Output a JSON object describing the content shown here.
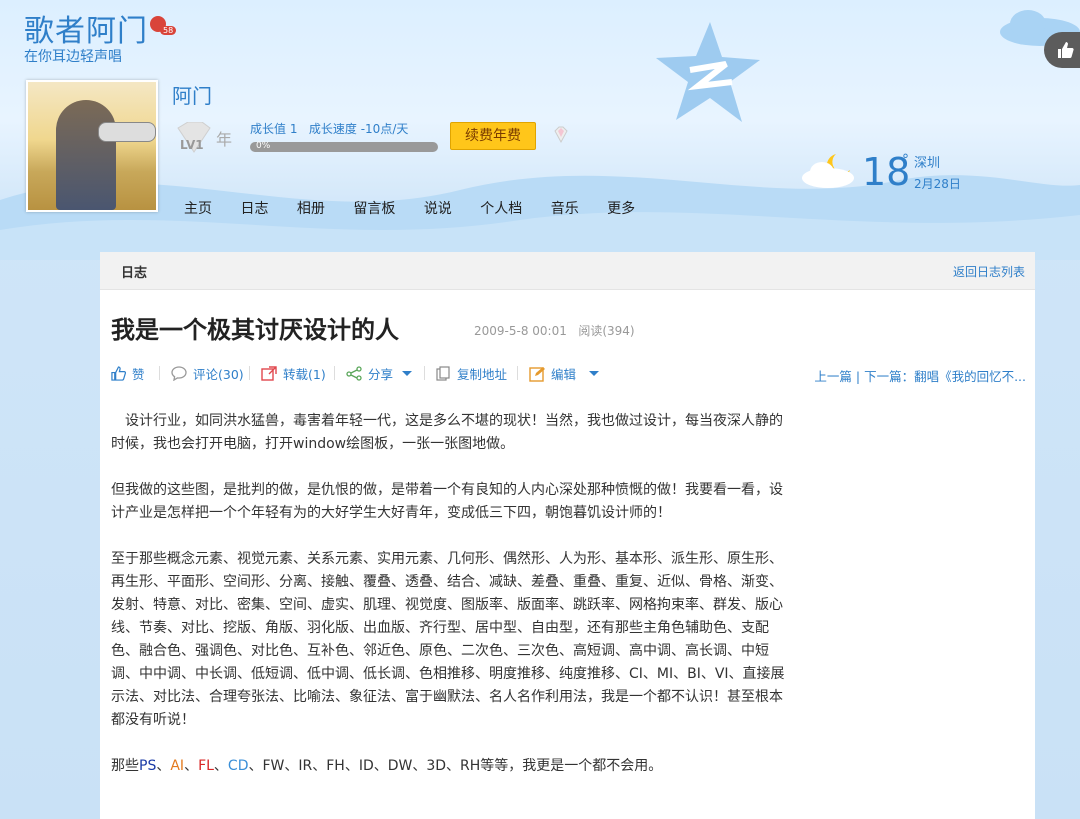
{
  "header": {
    "site_title": "歌者阿门",
    "site_subtitle": "在你耳边轻声唱",
    "apple_badge": "58",
    "username": "阿门",
    "level": "LV1",
    "year_label": "年",
    "growth_value": "成长值 1",
    "growth_speed": "成长速度 -10点/天",
    "growth_progress_percent": 0,
    "growth_progress_label": "0%",
    "renew_button": "续费年费"
  },
  "nav": {
    "items": [
      "主页",
      "日志",
      "相册",
      "留言板",
      "说说",
      "个人档",
      "音乐",
      "更多"
    ]
  },
  "weather": {
    "temperature": "18",
    "degree": "°",
    "city": "深圳",
    "date": "2月28日"
  },
  "panel": {
    "section_label": "日志",
    "back_link": "返回日志列表"
  },
  "post": {
    "title": "我是一个极其讨厌设计的人",
    "date": "2009-5-8 00:01",
    "reads": "阅读(394)",
    "actions": {
      "like": "赞",
      "comment": "评论(30)",
      "repost": "转载(1)",
      "share": "分享",
      "copy": "复制地址",
      "edit": "编辑"
    },
    "prev": "上一篇",
    "next_sep": " | ",
    "next": "下一篇：翻唱《我的回忆不...",
    "paragraph1": "　设计行业，如同洪水猛兽，毒害着年轻一代，这是多么不堪的现状！当然，我也做过设计，每当夜深人静的时候，我也会打开电脑，打开window绘图板，一张一张图地做。",
    "paragraph2": "但我做的这些图，是批判的做，是仇恨的做，是带着一个有良知的人内心深处那种愤慨的做！我要看一看，设计产业是怎样把一个个年轻有为的大好学生大好青年，变成低三下四，朝饱暮饥设计师的！",
    "paragraph3": "至于那些概念元素、视觉元素、关系元素、实用元素、几何形、偶然形、人为形、基本形、派生形、原生形、再生形、平面形、空间形、分离、接触、覆叠、透叠、结合、减缺、差叠、重叠、重复、近似、骨格、渐变、发射、特意、对比、密集、空间、虚实、肌理、视觉度、图版率、版面率、跳跃率、网格拘束率、群发、版心线、节奏、对比、挖版、角版、羽化版、出血版、齐行型、居中型、自由型，还有那些主角色辅助色、支配色、融合色、强调色、对比色、互补色、邻近色、原色、二次色、三次色、高短调、高中调、高长调、中短调、中中调、中长调、低短调、低中调、低长调、色相推移、明度推移、纯度推移、CI、MI、BI、VI、直接展示法、对比法、合理夸张法、比喻法、象征法、富于幽默法、名人名作利用法，我是一个都不认识！甚至根本都没有听说！",
    "p4_prefix": "那些",
    "p4_ps": "PS",
    "p4_sep1": "、",
    "p4_ai": "AI",
    "p4_sep2": "、",
    "p4_fl": "FL",
    "p4_sep3": "、",
    "p4_cd": "CD",
    "p4_rest": "、FW、IR、FH、ID、DW、3D、RH等等，我更是一个都不会用。"
  },
  "colors": {
    "accent": "#2f7fc9",
    "renew": "#ffc61a",
    "ps": "#1a3aa6",
    "ai": "#e37a1e",
    "fl": "#d82424",
    "cd": "#3a8fd8"
  },
  "icons": [
    "apple-icon",
    "diamond-icon",
    "thumb-up-icon",
    "comment-icon",
    "repost-icon",
    "share-icon",
    "copy-icon",
    "edit-icon",
    "chevron-down-icon",
    "weather-cloud-icon",
    "star-decoration"
  ]
}
